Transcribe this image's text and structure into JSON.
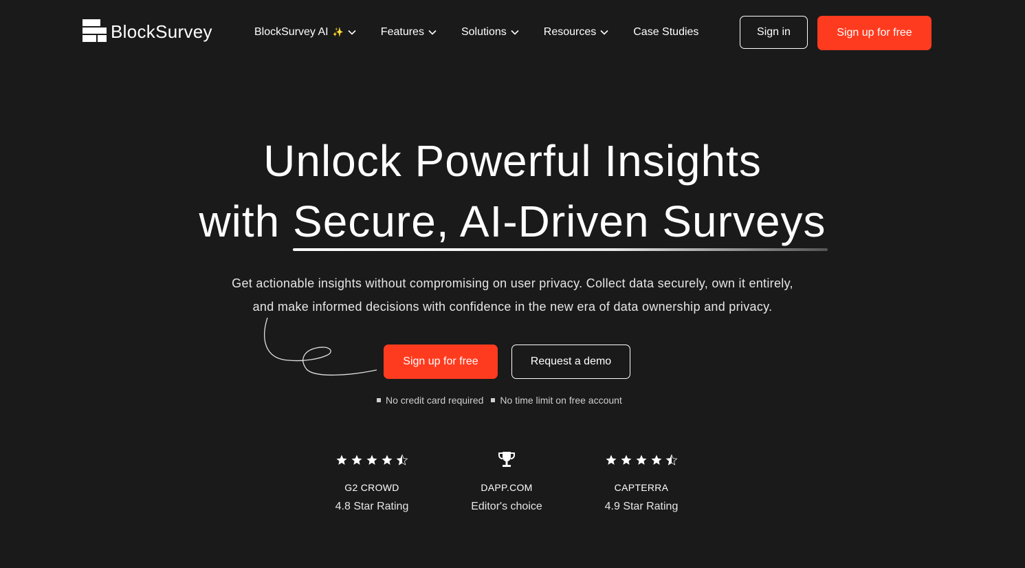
{
  "header": {
    "logo_text": "BlockSurvey",
    "nav": [
      {
        "label": "BlockSurvey AI",
        "sparkle": "✨",
        "dropdown": true
      },
      {
        "label": "Features",
        "dropdown": true
      },
      {
        "label": "Solutions",
        "dropdown": true
      },
      {
        "label": "Resources",
        "dropdown": true
      },
      {
        "label": "Case Studies",
        "dropdown": false
      }
    ],
    "sign_in": "Sign in",
    "sign_up": "Sign up for free"
  },
  "hero": {
    "line1": "Unlock Powerful Insights",
    "line2_prefix": "with ",
    "line2_highlight": "Secure, AI-Driven Surveys",
    "subtitle_line1": "Get actionable insights without compromising on user privacy. Collect data securely, own it entirely,",
    "subtitle_line2": "and make informed decisions with confidence in the new era of data ownership and privacy.",
    "cta_primary": "Sign up for free",
    "cta_secondary": "Request a demo",
    "notes": [
      "No credit card required",
      "No time limit on free account"
    ]
  },
  "ratings": [
    {
      "icon": "stars-icon",
      "stars": 4.8,
      "name": "G2 CROWD",
      "desc": "4.8 Star Rating"
    },
    {
      "icon": "trophy-icon",
      "name": "DAPP.COM",
      "desc": "Editor's choice"
    },
    {
      "icon": "stars-icon",
      "stars": 4.9,
      "name": "CAPTERRA",
      "desc": "4.9 Star Rating"
    }
  ],
  "colors": {
    "background": "#1a1a1a",
    "accent": "#ff3b1f",
    "text": "#ffffff",
    "sparkle": "#f7c948"
  }
}
